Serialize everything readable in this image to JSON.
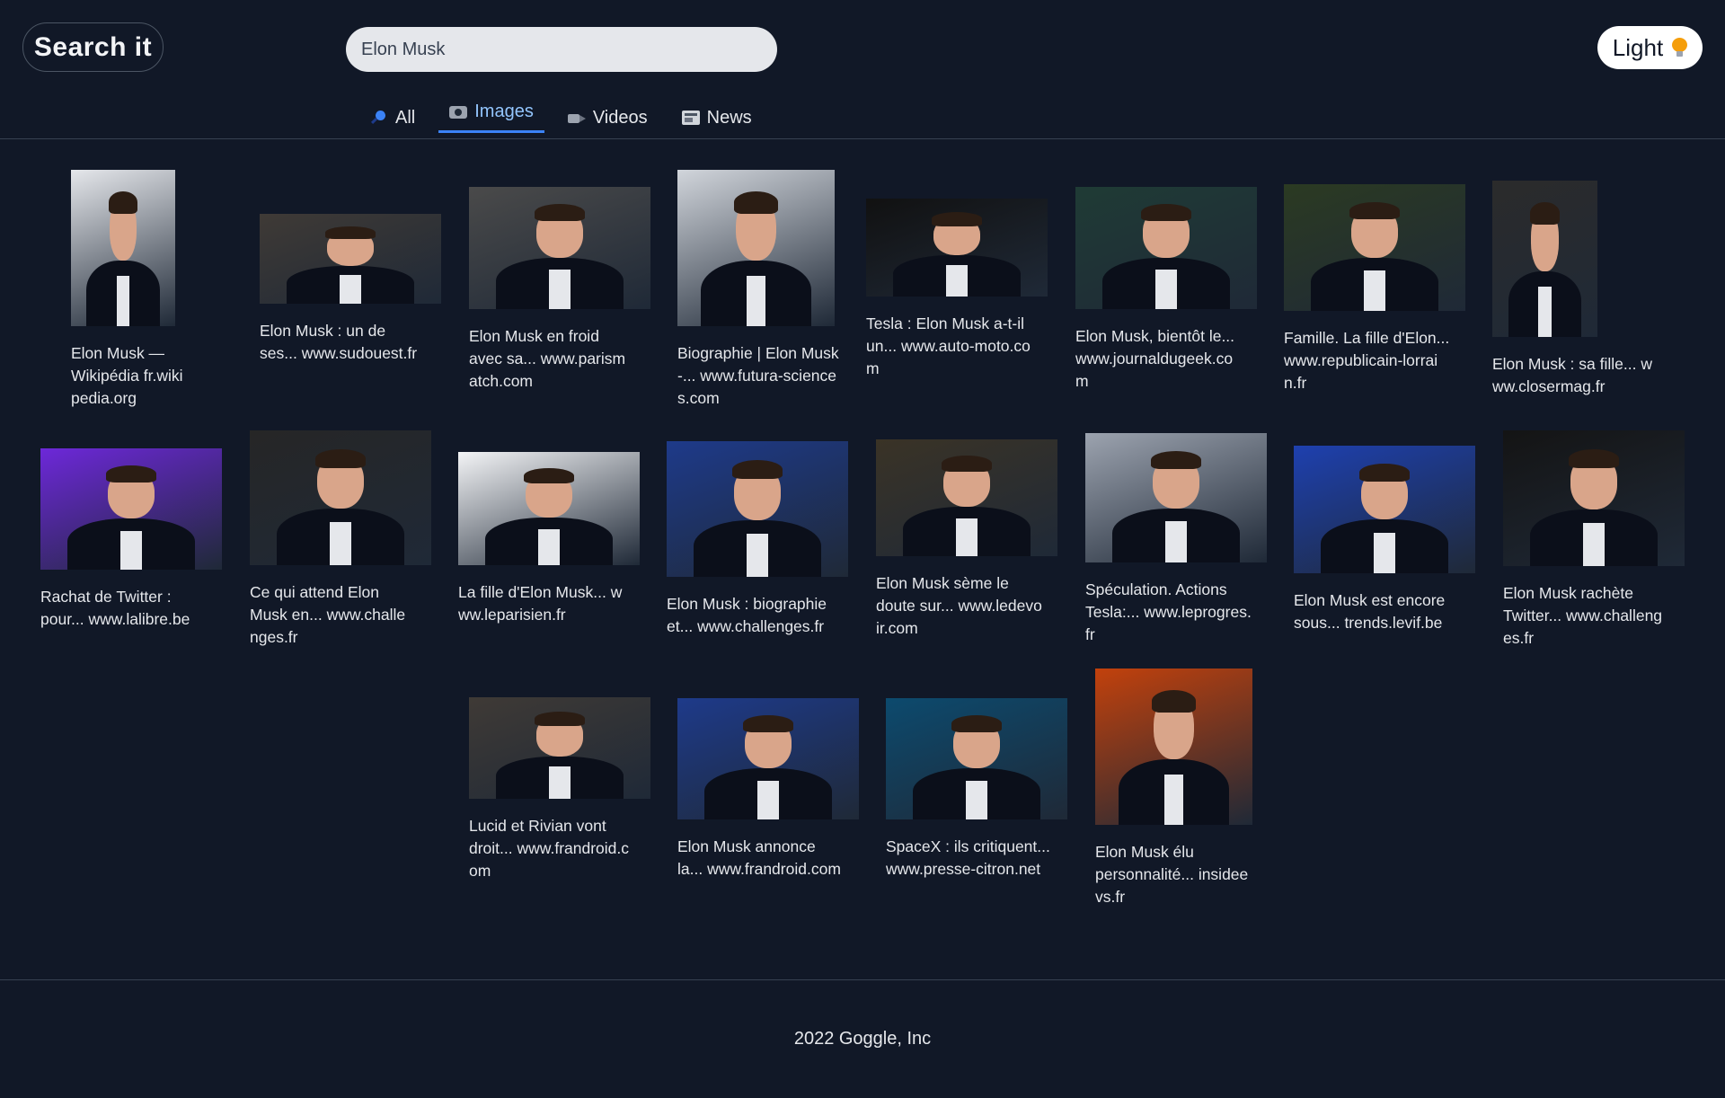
{
  "header": {
    "logo": "Search it",
    "search_value": "Elon Musk",
    "theme_label": "Light",
    "theme_icon": "lightbulb-icon"
  },
  "tabs": [
    {
      "label": "All",
      "icon": "magnifier-icon"
    },
    {
      "label": "Images",
      "icon": "camera-icon",
      "active": true
    },
    {
      "label": "Videos",
      "icon": "video-camera-icon"
    },
    {
      "label": "News",
      "icon": "newspaper-icon"
    }
  ],
  "results": [
    {
      "title": "Elon Musk — Wikipédia",
      "source": "fr.wikipedia.org",
      "bg": "#e5e7eb"
    },
    {
      "title": "Elon Musk : un de ses...",
      "source": "www.sudouest.fr",
      "bg": "#3f3a36"
    },
    {
      "title": "Elon Musk en froid avec sa...",
      "source": "www.parismatch.com",
      "bg": "#4a4a4a"
    },
    {
      "title": "Biographie | Elon Musk -...",
      "source": "www.futura-sciences.com",
      "bg": "#d1d5db"
    },
    {
      "title": "Tesla : Elon Musk a-t-il un...",
      "source": "www.auto-moto.com",
      "bg": "#111111"
    },
    {
      "title": "Elon Musk, bientôt le...",
      "source": "www.journaldugeek.com",
      "bg": "#1f3b35"
    },
    {
      "title": "Famille. La fille d'Elon...",
      "source": "www.republicain-lorrain.fr",
      "bg": "#2b3a22"
    },
    {
      "title": "Elon Musk : sa fille...",
      "source": "www.closermag.fr",
      "bg": "#2b2b2b"
    },
    {
      "title": "Rachat de Twitter : pour...",
      "source": "www.lalibre.be",
      "bg": "#6d28d9"
    },
    {
      "title": "Ce qui attend Elon Musk en...",
      "source": "www.challenges.fr",
      "bg": "#262626"
    },
    {
      "title": "La fille d'Elon Musk...",
      "source": "www.leparisien.fr",
      "bg": "#f3f4f6"
    },
    {
      "title": "Elon Musk : biographie et...",
      "source": "www.challenges.fr",
      "bg": "#1e3a8a"
    },
    {
      "title": "Elon Musk sème le doute sur...",
      "source": "www.ledevoir.com",
      "bg": "#3a3326"
    },
    {
      "title": "Spéculation. Actions Tesla:...",
      "source": "www.leprogres.fr",
      "bg": "#9ca3af"
    },
    {
      "title": "Elon Musk est encore sous...",
      "source": "trends.levif.be",
      "bg": "#1e40af"
    },
    {
      "title": "Elon Musk rachète Twitter...",
      "source": "www.challenges.fr",
      "bg": "#141414"
    },
    {
      "title": "Lucid et Rivian vont droit...",
      "source": "www.frandroid.com",
      "bg": "#3f3a36"
    },
    {
      "title": "Elon Musk annonce la...",
      "source": "www.frandroid.com",
      "bg": "#1e3a8a"
    },
    {
      "title": "SpaceX : ils critiquent...",
      "source": "www.presse-citron.net",
      "bg": "#0c4a6e"
    },
    {
      "title": "Elon Musk élu personnalité...",
      "source": "insideevs.fr",
      "bg": "#c2410c"
    }
  ],
  "footer": {
    "text": "2022 Goggle, Inc"
  }
}
